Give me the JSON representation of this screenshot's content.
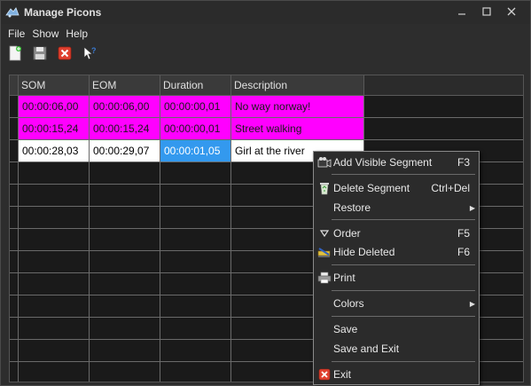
{
  "window": {
    "title": "Manage Picons",
    "controls": {
      "minimize": "—",
      "maximize": "☐",
      "close": "✕"
    }
  },
  "menubar": {
    "items": [
      {
        "label": "File"
      },
      {
        "label": "Show"
      },
      {
        "label": "Help"
      }
    ]
  },
  "toolbar": {
    "buttons": [
      {
        "icon": "new-document-icon"
      },
      {
        "icon": "save-icon"
      },
      {
        "icon": "delete-icon"
      },
      {
        "icon": "help-cursor-icon"
      }
    ]
  },
  "grid": {
    "columns": [
      "SOM",
      "EOM",
      "Duration",
      "Description"
    ],
    "rows": [
      {
        "som": "00:00:06,00",
        "eom": "00:00:06,00",
        "duration": "00:00:00,01",
        "description": "No way norway!",
        "style": "magenta"
      },
      {
        "som": "00:00:15,24",
        "eom": "00:00:15,24",
        "duration": "00:00:00,01",
        "description": "Street walking",
        "style": "magenta"
      },
      {
        "som": "00:00:28,03",
        "eom": "00:00:29,07",
        "duration": "00:00:01,05",
        "description": "Girl at the river",
        "style": "selected"
      }
    ],
    "empty_row_count": 10
  },
  "context_menu": {
    "items": [
      {
        "label": "Add Visible Segment",
        "shortcut": "F3",
        "icon": "camera-icon"
      },
      {
        "label": "Delete Segment",
        "shortcut": "Ctrl+Del",
        "icon": "recycle-bin-icon"
      },
      {
        "label": "Restore",
        "submenu": true
      },
      {
        "label": "Order",
        "shortcut": "F5",
        "icon": "sort-icon"
      },
      {
        "label": "Hide Deleted",
        "shortcut": "F6",
        "icon": "hide-icon"
      },
      {
        "label": "Print",
        "icon": "printer-icon"
      },
      {
        "label": "Colors",
        "submenu": true
      },
      {
        "label": "Save"
      },
      {
        "label": "Save and Exit"
      },
      {
        "label": "Exit",
        "icon": "exit-icon"
      }
    ]
  },
  "colors": {
    "row_highlight": "#ff00ff",
    "selection": "#3399ee",
    "background": "#1a1a1a"
  }
}
